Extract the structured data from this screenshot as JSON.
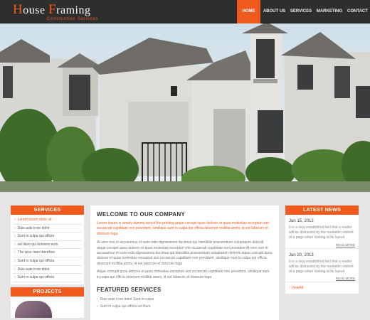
{
  "header": {
    "logo_word1": "ouse",
    "logo_cap1": "H",
    "logo_cap2": "F",
    "logo_word2": "raming",
    "logo_tagline": "Constuction Services",
    "nav": [
      "HOME",
      "ABOUT US",
      "SERVICES",
      "MARKETING",
      "CONTACT"
    ],
    "active_nav": "HOME"
  },
  "colors": {
    "accent": "#f05a1c",
    "header_bg": "#2e2e2e",
    "page_bg": "#e6e6e6"
  },
  "services": {
    "title": "SERVICES",
    "items": [
      "Lorem ipsum dolor sit",
      "Duis aute irure dolor",
      "Sunt in culpa qui officia",
      "vel illum qui dolorem eum",
      "The wise man therefore",
      "Sunt in culpa qui officia",
      "Duis aute irure dolor",
      "Sunt in culpa qui officia"
    ]
  },
  "projects": {
    "title": "PROJECTS"
  },
  "welcome": {
    "title": "WELCOME TO OUR COMPANY",
    "highlight": "Lorem Ipsum is simply dummy text of the printing atque corrupti quos dolores et quas molestias excepturi sint occaecati cupiditate non provident, similique sunt in culpa qui officia deserunt mollitia animi, id est laborum et dolorum fuga.",
    "para1": "At vero eos et accusamus et iusto odio dignissimos ducimus qui blanditiis praesentium voluptatum deleniti atque corrupti quos dolores et quas molestias excepturi sint occaecati cupiditate non provident At vero eos et accusamus et iusto odio dignissimos ducimus qui blanditiis praesentium voluptatum deleniti atque corrupti quos dolores et quas molestias excepturi sint occaecati cupiditate non provident, similique sunt in culpa qui officia deserunt mollitia animi, id est laborum et dolorum fuga",
    "para2": "Atque corrupti quos dolores et quas molestias excepturi sint occaecati cupiditate non provident, similique sunt in culpa qui officia deserunt mollitia animi, id est laborum et dolorum fuga"
  },
  "featured": {
    "title": "FEATURED SERVICES",
    "items": [
      "Duis aute irure dolor Sunt in culpa",
      "Sunt in culpa qui officia vel illum"
    ]
  },
  "news": {
    "title": "LATEST NEWS",
    "items": [
      {
        "date": "Jan 15, 2012",
        "text": "It is a long established fact that a reader will be distracted by the readable content of a page when looking at its layout",
        "more": "READ MORE"
      },
      {
        "date": "Jan 20, 2013",
        "text": "It is a long established fact that a reader will be distracted by the readable content of a page when looking at its layout",
        "more": "READ MORE"
      }
    ],
    "view_all": "ViewAll"
  }
}
